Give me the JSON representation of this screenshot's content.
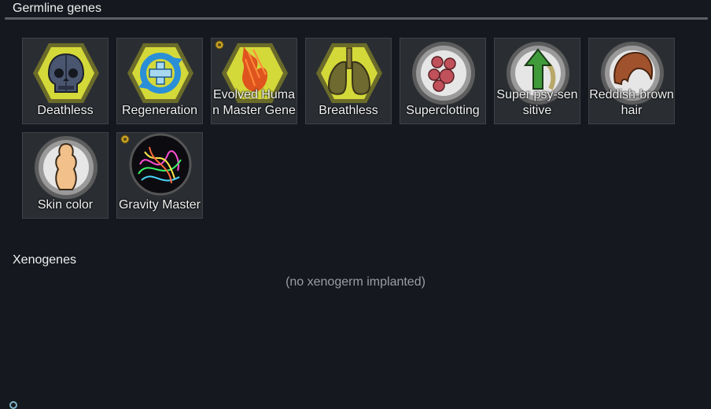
{
  "germline": {
    "title": "Germline genes",
    "genes": [
      {
        "label": "Deathless",
        "icon": "skull-icon",
        "archite": false
      },
      {
        "label": "Regeneration",
        "icon": "regeneration-arrows-icon",
        "archite": false
      },
      {
        "label": "Evolved Human Master Gene",
        "icon": "flame-icon",
        "archite": true
      },
      {
        "label": "Breathless",
        "icon": "lungs-icon",
        "archite": false
      },
      {
        "label": "Superclotting",
        "icon": "blood-cells-icon",
        "archite": false
      },
      {
        "label": "Super psy-sensitive",
        "icon": "psy-arrow-icon",
        "archite": false
      },
      {
        "label": "Reddish-brown hair",
        "icon": "hair-icon",
        "archite": false
      },
      {
        "label": "Skin color",
        "icon": "skin-figure-icon",
        "archite": false
      },
      {
        "label": "Gravity Master",
        "icon": "gravity-orb-icon",
        "archite": true
      }
    ]
  },
  "xenogenes": {
    "title": "Xenogenes",
    "empty_text": "(no xenogerm implanted)"
  },
  "colors": {
    "background": "#15191f",
    "tile": "#2a2e33",
    "hex_yellow": "#d4d93a",
    "circle_gray": "#8f8f8f"
  }
}
